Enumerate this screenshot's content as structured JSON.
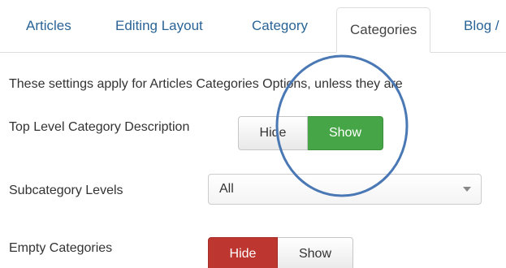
{
  "tabs": [
    {
      "label": "Articles",
      "active": false
    },
    {
      "label": "Editing Layout",
      "active": false
    },
    {
      "label": "Category",
      "active": false
    },
    {
      "label": "Categories",
      "active": true
    },
    {
      "label": "Blog /",
      "active": false
    }
  ],
  "intro_text": "These settings apply for Articles Categories Options, unless they are",
  "fields": {
    "top_level_category_description": {
      "label": "Top Level Category Description",
      "options": [
        "Hide",
        "Show"
      ],
      "selected": "Show"
    },
    "subcategory_levels": {
      "label": "Subcategory Levels",
      "value": "All"
    },
    "empty_categories": {
      "label": "Empty Categories",
      "options": [
        "Hide",
        "Show"
      ],
      "selected": "Hide"
    }
  },
  "colors": {
    "tab_link": "#2a6496",
    "active_green": "#46a546",
    "active_red": "#bd362f",
    "annotation_circle": "#4a78b5"
  }
}
